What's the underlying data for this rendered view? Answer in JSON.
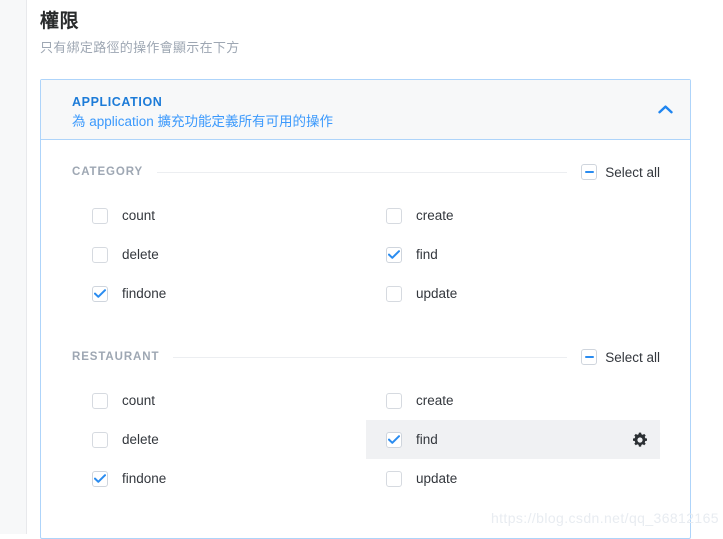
{
  "page": {
    "title": "權限",
    "subtitle": "只有綁定路徑的操作會顯示在下方"
  },
  "card": {
    "title": "APPLICATION",
    "description": "為 application 擴充功能定義所有可用的操作",
    "collapse_icon": "chevron-up-icon",
    "expanded": true
  },
  "groups": [
    {
      "label": "CATEGORY",
      "select_all_label": "Select all",
      "select_all_state": "indeterminate",
      "options": [
        {
          "label": "count",
          "checked": false,
          "highlighted": false,
          "gear": false
        },
        {
          "label": "create",
          "checked": false,
          "highlighted": false,
          "gear": false
        },
        {
          "label": "delete",
          "checked": false,
          "highlighted": false,
          "gear": false
        },
        {
          "label": "find",
          "checked": true,
          "highlighted": false,
          "gear": false
        },
        {
          "label": "findone",
          "checked": true,
          "highlighted": false,
          "gear": false
        },
        {
          "label": "update",
          "checked": false,
          "highlighted": false,
          "gear": false
        }
      ]
    },
    {
      "label": "RESTAURANT",
      "select_all_label": "Select all",
      "select_all_state": "indeterminate",
      "options": [
        {
          "label": "count",
          "checked": false,
          "highlighted": false,
          "gear": false
        },
        {
          "label": "create",
          "checked": false,
          "highlighted": false,
          "gear": false
        },
        {
          "label": "delete",
          "checked": false,
          "highlighted": false,
          "gear": false
        },
        {
          "label": "find",
          "checked": true,
          "highlighted": true,
          "gear": true
        },
        {
          "label": "findone",
          "checked": true,
          "highlighted": false,
          "gear": false
        },
        {
          "label": "update",
          "checked": false,
          "highlighted": false,
          "gear": false
        }
      ]
    }
  ],
  "watermark": {
    "text": "https://blog.csdn.net/qq_36812165"
  },
  "colors": {
    "accent": "#2a8cf0",
    "link": "#3b99fc",
    "heading": "#1c7bd8",
    "muted": "#9ea7b3",
    "card_border": "#aed4fa",
    "highlight_row": "#f0f1f3"
  }
}
